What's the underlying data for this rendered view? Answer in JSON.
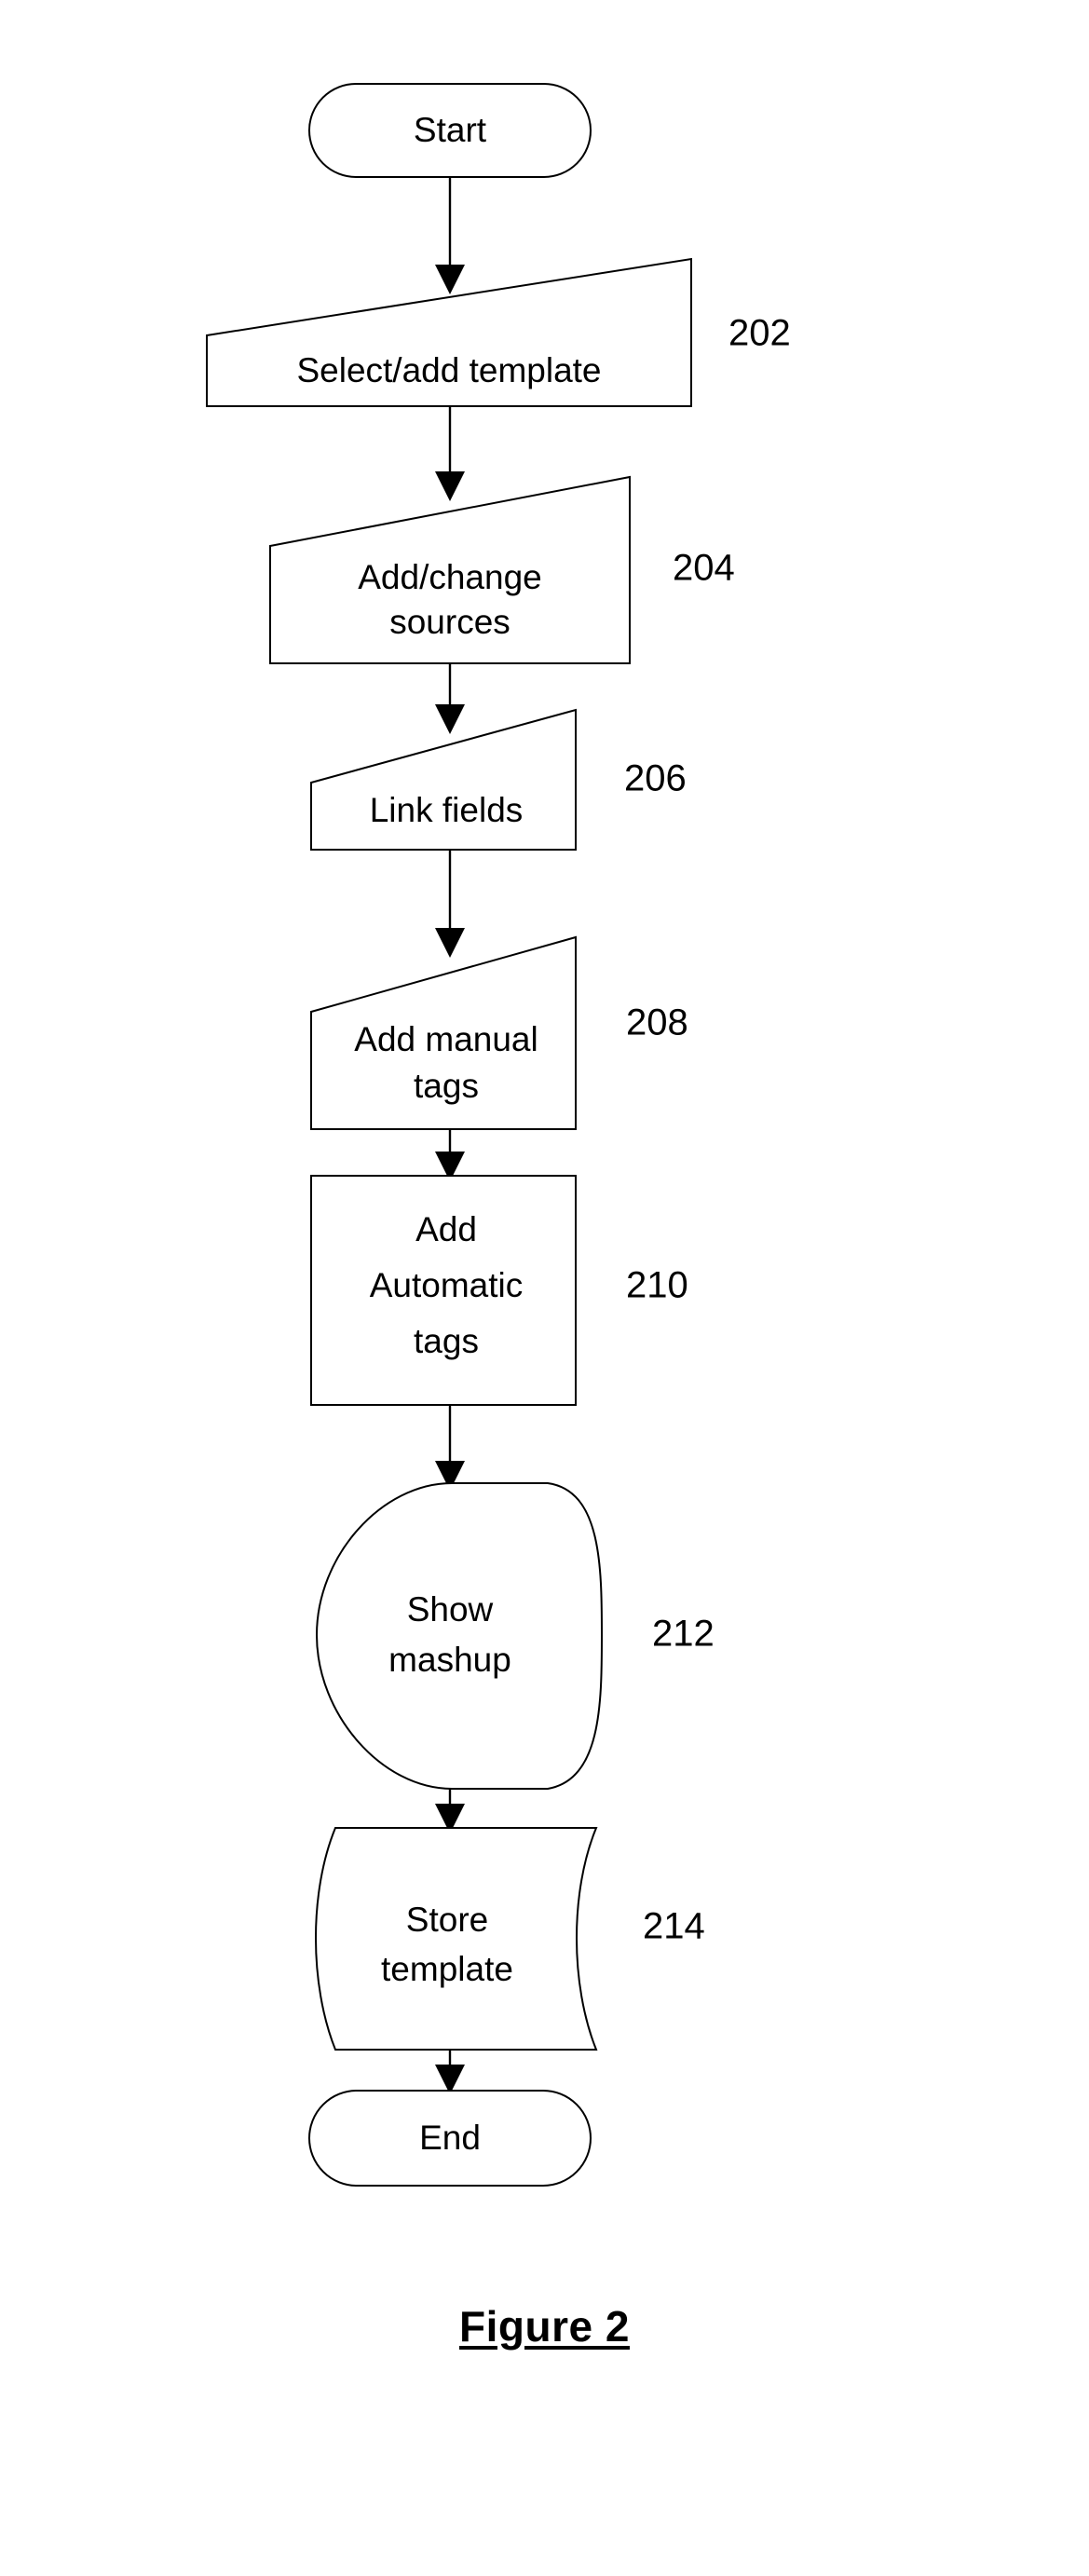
{
  "figure": {
    "caption": "Figure 2",
    "background_color": "#ffffff",
    "line_color": "#000000"
  },
  "chart_data": {
    "type": "diagram",
    "diagram_type": "flowchart",
    "title": "Figure 2",
    "orientation": "top-to-bottom",
    "nodes": [
      {
        "id": "start",
        "label": "Start",
        "shape": "terminator",
        "ref": ""
      },
      {
        "id": "n202",
        "label": "Select/add template",
        "shape": "manual-input",
        "ref": "202"
      },
      {
        "id": "n204",
        "label": "Add/change sources",
        "shape": "manual-input",
        "ref": "204"
      },
      {
        "id": "n206",
        "label": "Link fields",
        "shape": "manual-input",
        "ref": "206"
      },
      {
        "id": "n208",
        "label": "Add manual tags",
        "shape": "manual-input",
        "ref": "208"
      },
      {
        "id": "n210",
        "label": "Add Automatic tags",
        "shape": "process",
        "ref": "210"
      },
      {
        "id": "n212",
        "label": "Show mashup",
        "shape": "display",
        "ref": "212"
      },
      {
        "id": "n214",
        "label": "Store template",
        "shape": "stored-data",
        "ref": "214"
      },
      {
        "id": "end",
        "label": "End",
        "shape": "terminator",
        "ref": ""
      }
    ],
    "edges": [
      {
        "from": "start",
        "to": "n202",
        "label": ""
      },
      {
        "from": "n202",
        "to": "n204",
        "label": ""
      },
      {
        "from": "n204",
        "to": "n206",
        "label": ""
      },
      {
        "from": "n206",
        "to": "n208",
        "label": ""
      },
      {
        "from": "n208",
        "to": "n210",
        "label": ""
      },
      {
        "from": "n210",
        "to": "n212",
        "label": ""
      },
      {
        "from": "n212",
        "to": "n214",
        "label": ""
      },
      {
        "from": "n214",
        "to": "end",
        "label": ""
      }
    ]
  },
  "nodes": {
    "start": {
      "line1": "Start"
    },
    "n202": {
      "line1": "Select/add template",
      "ref": "202"
    },
    "n204": {
      "line1": "Add/change",
      "line2": "sources",
      "ref": "204"
    },
    "n206": {
      "line1": "Link fields",
      "ref": "206"
    },
    "n208": {
      "line1": "Add manual",
      "line2": "tags",
      "ref": "208"
    },
    "n210": {
      "line1": "Add",
      "line2": "Automatic",
      "line3": "tags",
      "ref": "210"
    },
    "n212": {
      "line1": "Show",
      "line2": "mashup",
      "ref": "212"
    },
    "n214": {
      "line1": "Store",
      "line2": "template",
      "ref": "214"
    },
    "end": {
      "line1": "End"
    }
  }
}
